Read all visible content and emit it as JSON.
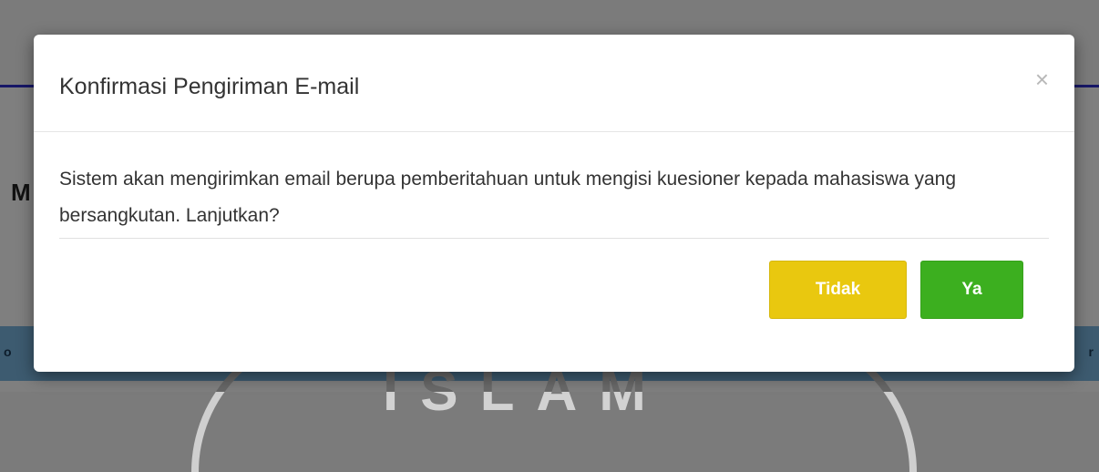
{
  "background": {
    "heading_letter": "M",
    "bar_left_text": "o",
    "bar_right_text": "r",
    "watermark_text": "ISLAM"
  },
  "modal": {
    "title": "Konfirmasi Pengiriman E-mail",
    "close_label": "×",
    "message": "Sistem akan mengirimkan email berupa pemberitahuan untuk mengisi kuesioner kepada mahasiswa yang bersangkutan. Lanjutkan?",
    "buttons": {
      "no_label": "Tidak",
      "yes_label": "Ya"
    }
  },
  "colors": {
    "no_button": "#e9c80f",
    "yes_button": "#3caf1f",
    "header_accent": "#2f2fcf"
  }
}
